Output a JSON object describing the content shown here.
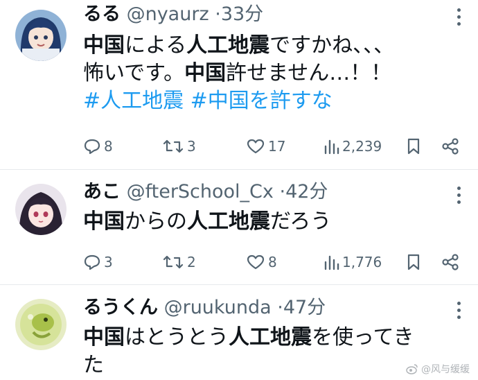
{
  "posts": [
    {
      "name": "るる",
      "handle": "@nyaurz",
      "sep": "·",
      "time": "33分",
      "body_lines": [
        [
          {
            "t": "中国",
            "b": true
          },
          {
            "t": "による",
            "b": false
          },
          {
            "t": "人工地震",
            "b": true
          },
          {
            "t": "ですかね、、、",
            "b": false
          }
        ],
        [
          {
            "t": "怖いです。",
            "b": false
          },
          {
            "t": "中国",
            "b": true
          },
          {
            "t": "許せません…！！",
            "b": false
          }
        ]
      ],
      "hashtags": "#人工地震 #中国を許すな",
      "replies": "8",
      "reposts": "3",
      "likes": "17",
      "views": "2,239"
    },
    {
      "name": "あこ",
      "handle": "@fterSchool_Cx",
      "sep": "·",
      "time": "42分",
      "body_lines": [
        [
          {
            "t": "中国",
            "b": true
          },
          {
            "t": "からの",
            "b": false
          },
          {
            "t": "人工地震",
            "b": true
          },
          {
            "t": "だろう",
            "b": false
          }
        ]
      ],
      "replies": "3",
      "reposts": "2",
      "likes": "8",
      "views": "1,776"
    },
    {
      "name": "るうくん",
      "handle": "@ruukunda",
      "sep": "·",
      "time": "47分",
      "body_lines": [
        [
          {
            "t": "中国",
            "b": true
          },
          {
            "t": "はとうとう",
            "b": false
          },
          {
            "t": "人工地震",
            "b": true
          },
          {
            "t": "を使ってき",
            "b": false
          }
        ],
        [
          {
            "t": "た",
            "b": false
          }
        ]
      ]
    }
  ],
  "watermark": "@风与缓缓",
  "colors": {
    "text": "#0f1419",
    "muted": "#536471",
    "link": "#1d9bf0",
    "divider": "#e6e9ec"
  }
}
